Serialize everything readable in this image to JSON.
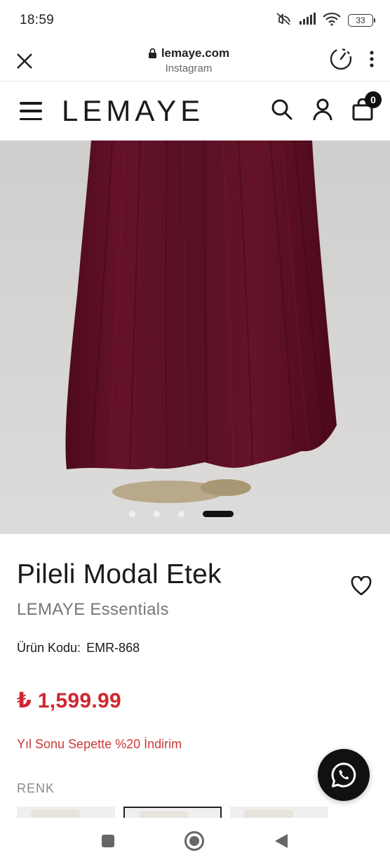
{
  "status_bar": {
    "time": "18:59",
    "battery": "33",
    "icons": [
      "mute-icon",
      "signal-icon",
      "wifi-icon",
      "battery-icon"
    ]
  },
  "browser": {
    "url": "lemaye.com",
    "subtitle": "Instagram",
    "icons": [
      "close-icon",
      "lock-icon",
      "speed-icon",
      "more-vert-icon"
    ]
  },
  "header": {
    "logo": "LEMAYE",
    "cart_count": "0",
    "icons": [
      "menu-icon",
      "search-icon",
      "user-icon",
      "cart-icon"
    ]
  },
  "gallery": {
    "slide_count": 4,
    "active_slide": 4,
    "colors": {
      "background": "#d3d2d0",
      "fabric": "#5e0f22"
    }
  },
  "product": {
    "title": "Pileli Modal Etek",
    "brand": "LEMAYE Essentials",
    "code_label": "Ürün Kodu:",
    "code_value": "EMR-868",
    "price": "₺ 1,599.99",
    "promo": "Yıl Sonu Sepette %20 İndirim",
    "color_label": "RENK",
    "selected_swatch": 2,
    "colors": {
      "price": "#d0262f",
      "promo": "#c83b3b"
    }
  },
  "fab": {
    "icon": "whatsapp-icon"
  },
  "nav_bar": {
    "icons": [
      "recent-apps-icon",
      "home-icon",
      "back-icon"
    ]
  }
}
